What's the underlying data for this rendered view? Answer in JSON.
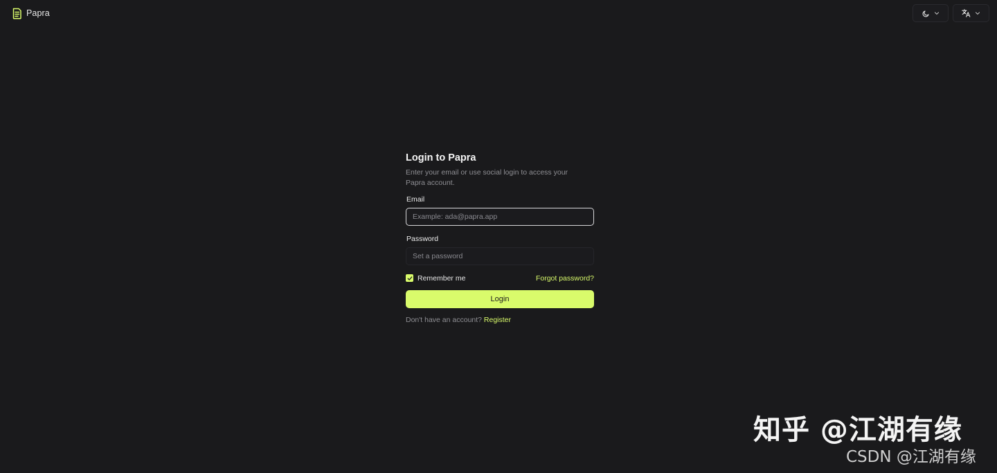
{
  "header": {
    "app_name": "Papra",
    "logo_icon": "papra-document-icon",
    "theme_icon": "moon-icon",
    "language_icon": "translate-icon",
    "accent_color": "#d9fb6b"
  },
  "login": {
    "title": "Login to Papra",
    "subtitle": "Enter your email or use social login to access your Papra account.",
    "email_label": "Email",
    "email_placeholder": "Example: ada@papra.app",
    "email_value": "",
    "password_label": "Password",
    "password_placeholder": "Set a password",
    "password_value": "",
    "remember_label": "Remember me",
    "remember_checked": true,
    "forgot_label": "Forgot password?",
    "login_button": "Login",
    "no_account_text": "Don't have an account?",
    "register_label": "Register"
  },
  "watermark": {
    "primary": "知乎 @江湖有缘",
    "secondary": "CSDN @江湖有缘"
  }
}
